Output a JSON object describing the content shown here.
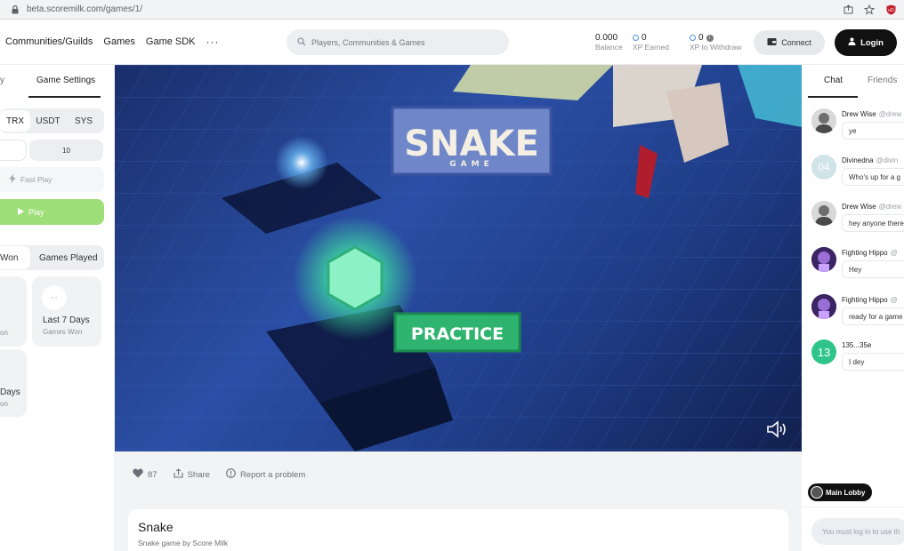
{
  "browser": {
    "url": "beta.scoremilk.com/games/1/"
  },
  "nav": {
    "links": [
      "Communities/Guilds",
      "Games",
      "Game SDK"
    ],
    "more": "···",
    "search_placeholder": "Players, Communities & Games",
    "balance_value": "0.000",
    "balance_label": "Balance",
    "xp_earned_value": "0",
    "xp_earned_label": "XP Earned",
    "xp_withdraw_value": "0",
    "xp_withdraw_label": "XP to Withdraw",
    "connect_label": "Connect",
    "login_label": "Login",
    "accent_color": "#4f8fe3"
  },
  "left": {
    "tab_lobby": "y",
    "tab_settings": "Game Settings",
    "currencies": [
      "TRX",
      "USDT",
      "SYS"
    ],
    "selected_currency": "TRX",
    "amount_option": "10",
    "fast_play_label": "Fast Play",
    "play_label": "Play",
    "stats_tabs": [
      "Won",
      "Games Played"
    ],
    "cards": [
      {
        "big": "",
        "small": "on"
      },
      {
        "big": "Last 7 Days",
        "small": "Games Won",
        "face": "-.-"
      },
      {
        "big": "Days",
        "small": "on"
      }
    ]
  },
  "game": {
    "title_text": "SNAKE",
    "subtitle_text": "GAME",
    "practice_label": "PRACTICE",
    "volume_icon": "volume-icon"
  },
  "below": {
    "likes": "87",
    "share_label": "Share",
    "report_label": "Report a problem",
    "game_title": "Snake",
    "game_subtitle": "Snake game by Score Milk"
  },
  "chat": {
    "tab_chat": "Chat",
    "tab_friends": "Friends",
    "messages": [
      {
        "name": "Drew Wise",
        "handle": "@drew",
        "text": "ye"
      },
      {
        "name": "Divinedna",
        "handle": "@divin",
        "text": "Who's up for a g",
        "avatar_text": "04"
      },
      {
        "name": "Drew Wise",
        "handle": "@drew",
        "text": "hey anyone there"
      },
      {
        "name": "Fighting Hippo",
        "handle": "@",
        "text": "Hey"
      },
      {
        "name": "Fighting Hippo",
        "handle": "@",
        "text": "ready for a game"
      },
      {
        "name": "135...35e",
        "handle": "",
        "text": "I dey",
        "avatar_text": "13"
      }
    ],
    "main_lobby_label": "Main Lobby",
    "input_placeholder": "You must log in to use th"
  }
}
